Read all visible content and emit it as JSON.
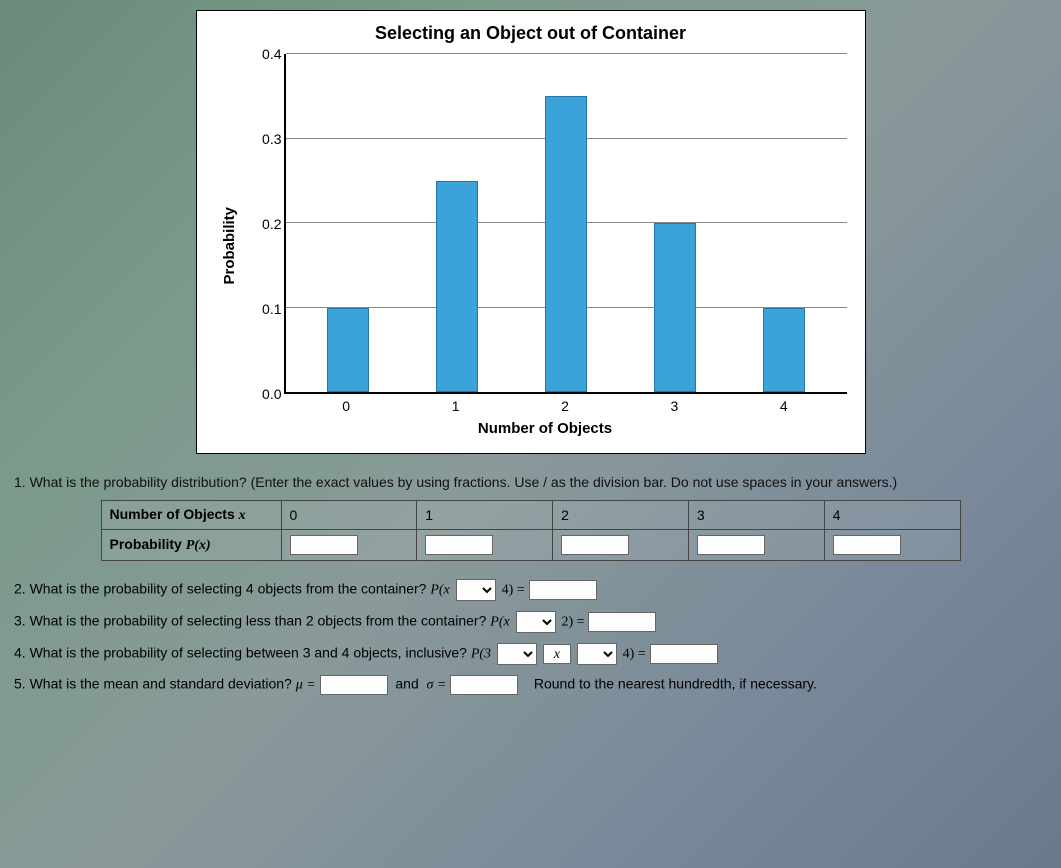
{
  "chart_data": {
    "type": "bar",
    "title": "Selecting an Object out of Container",
    "xlabel": "Number of Objects",
    "ylabel": "Probability",
    "categories": [
      "0",
      "1",
      "2",
      "3",
      "4"
    ],
    "values": [
      0.1,
      0.25,
      0.35,
      0.2,
      0.1
    ],
    "ylim": [
      0.0,
      0.4
    ],
    "yticks": [
      "0.0",
      "0.1",
      "0.2",
      "0.3",
      "0.4"
    ]
  },
  "q1": {
    "text": "1. What is the probability distribution? (Enter the exact values by using fractions. Use / as the division bar. Do not use spaces in your answers.)",
    "row1_label_pre": "Number of Objects ",
    "row1_label_var": "x",
    "row1_cols": [
      "0",
      "1",
      "2",
      "3",
      "4"
    ],
    "row2_label_pre": "Probability ",
    "row2_label_fn": "P(x)"
  },
  "q2": {
    "text_pre": "2. What is the probability of selecting 4 objects from the container? ",
    "expr_open": "P(x",
    "expr_mid": "4) ="
  },
  "q3": {
    "text_pre": "3. What is the probability of selecting less than 2 objects from the container? ",
    "expr_open": "P(x",
    "expr_mid": "2) ="
  },
  "q4": {
    "text_pre": "4. What is the probability of selecting between 3 and 4 objects, inclusive? ",
    "expr_open": "P(3",
    "expr_var": "x",
    "expr_mid": "4) ="
  },
  "q5": {
    "text_pre": "5. What is the mean and standard deviation? ",
    "mu": "μ =",
    "and": "and",
    "sigma": "σ =",
    "round": "Round to the nearest hundredth, if necessary."
  }
}
